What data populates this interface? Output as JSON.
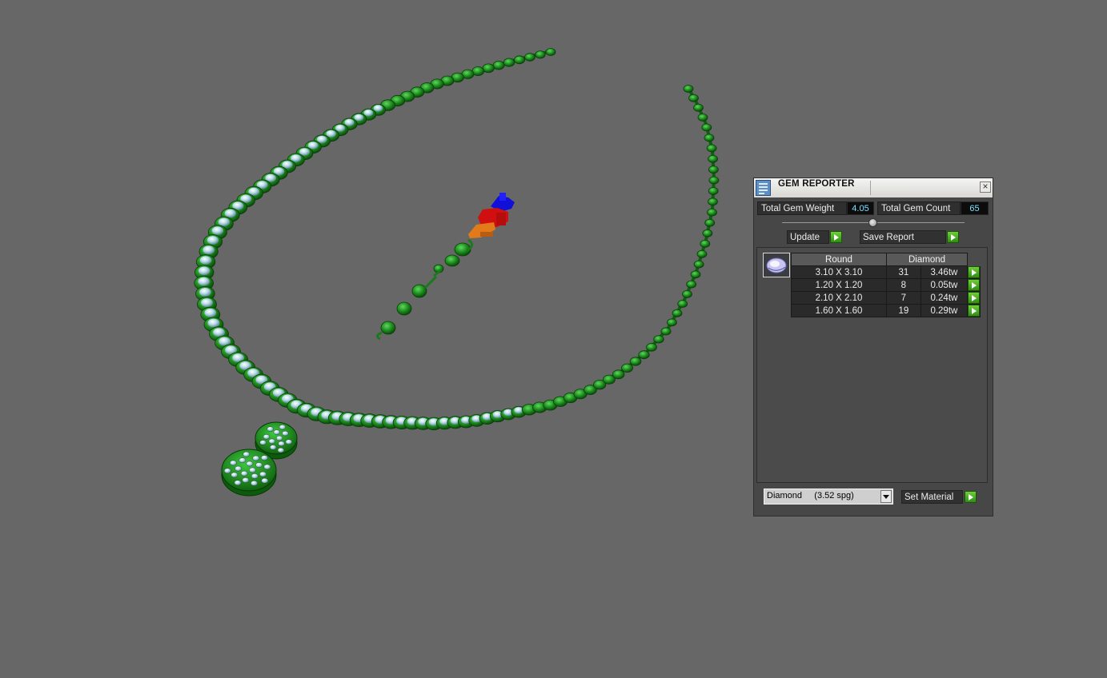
{
  "panel": {
    "title": "GEM REPORTER",
    "close_glyph": "×",
    "total_weight_label": "Total Gem Weight",
    "total_weight_value": "4.05",
    "total_count_label": "Total Gem Count",
    "total_count_value": "65",
    "update_label": "Update",
    "save_report_label": "Save Report",
    "table": {
      "shape_header": "Round",
      "material_header": "Diamond",
      "rows": [
        {
          "size": "3.10 X 3.10",
          "count": "31",
          "weight": "3.46tw"
        },
        {
          "size": "1.20 X 1.20",
          "count": "8",
          "weight": "0.05tw"
        },
        {
          "size": "2.10 X 2.10",
          "count": "7",
          "weight": "0.24tw"
        },
        {
          "size": "1.60 X 1.60",
          "count": "19",
          "weight": "0.29tw"
        }
      ]
    },
    "material_select": "Diamond     (3.52 spg)",
    "set_material_label": "Set Material"
  },
  "icons": {
    "title_icon": "report-icon",
    "gem_thumb": "round-gem-icon",
    "go_arrow": "play-arrow-icon"
  },
  "colors": {
    "background": "#686768",
    "metal": "#1e8a1e",
    "gem": "#bfe6f0",
    "accent_arrow": "#4fb527",
    "value_text": "#7fe0ff"
  }
}
